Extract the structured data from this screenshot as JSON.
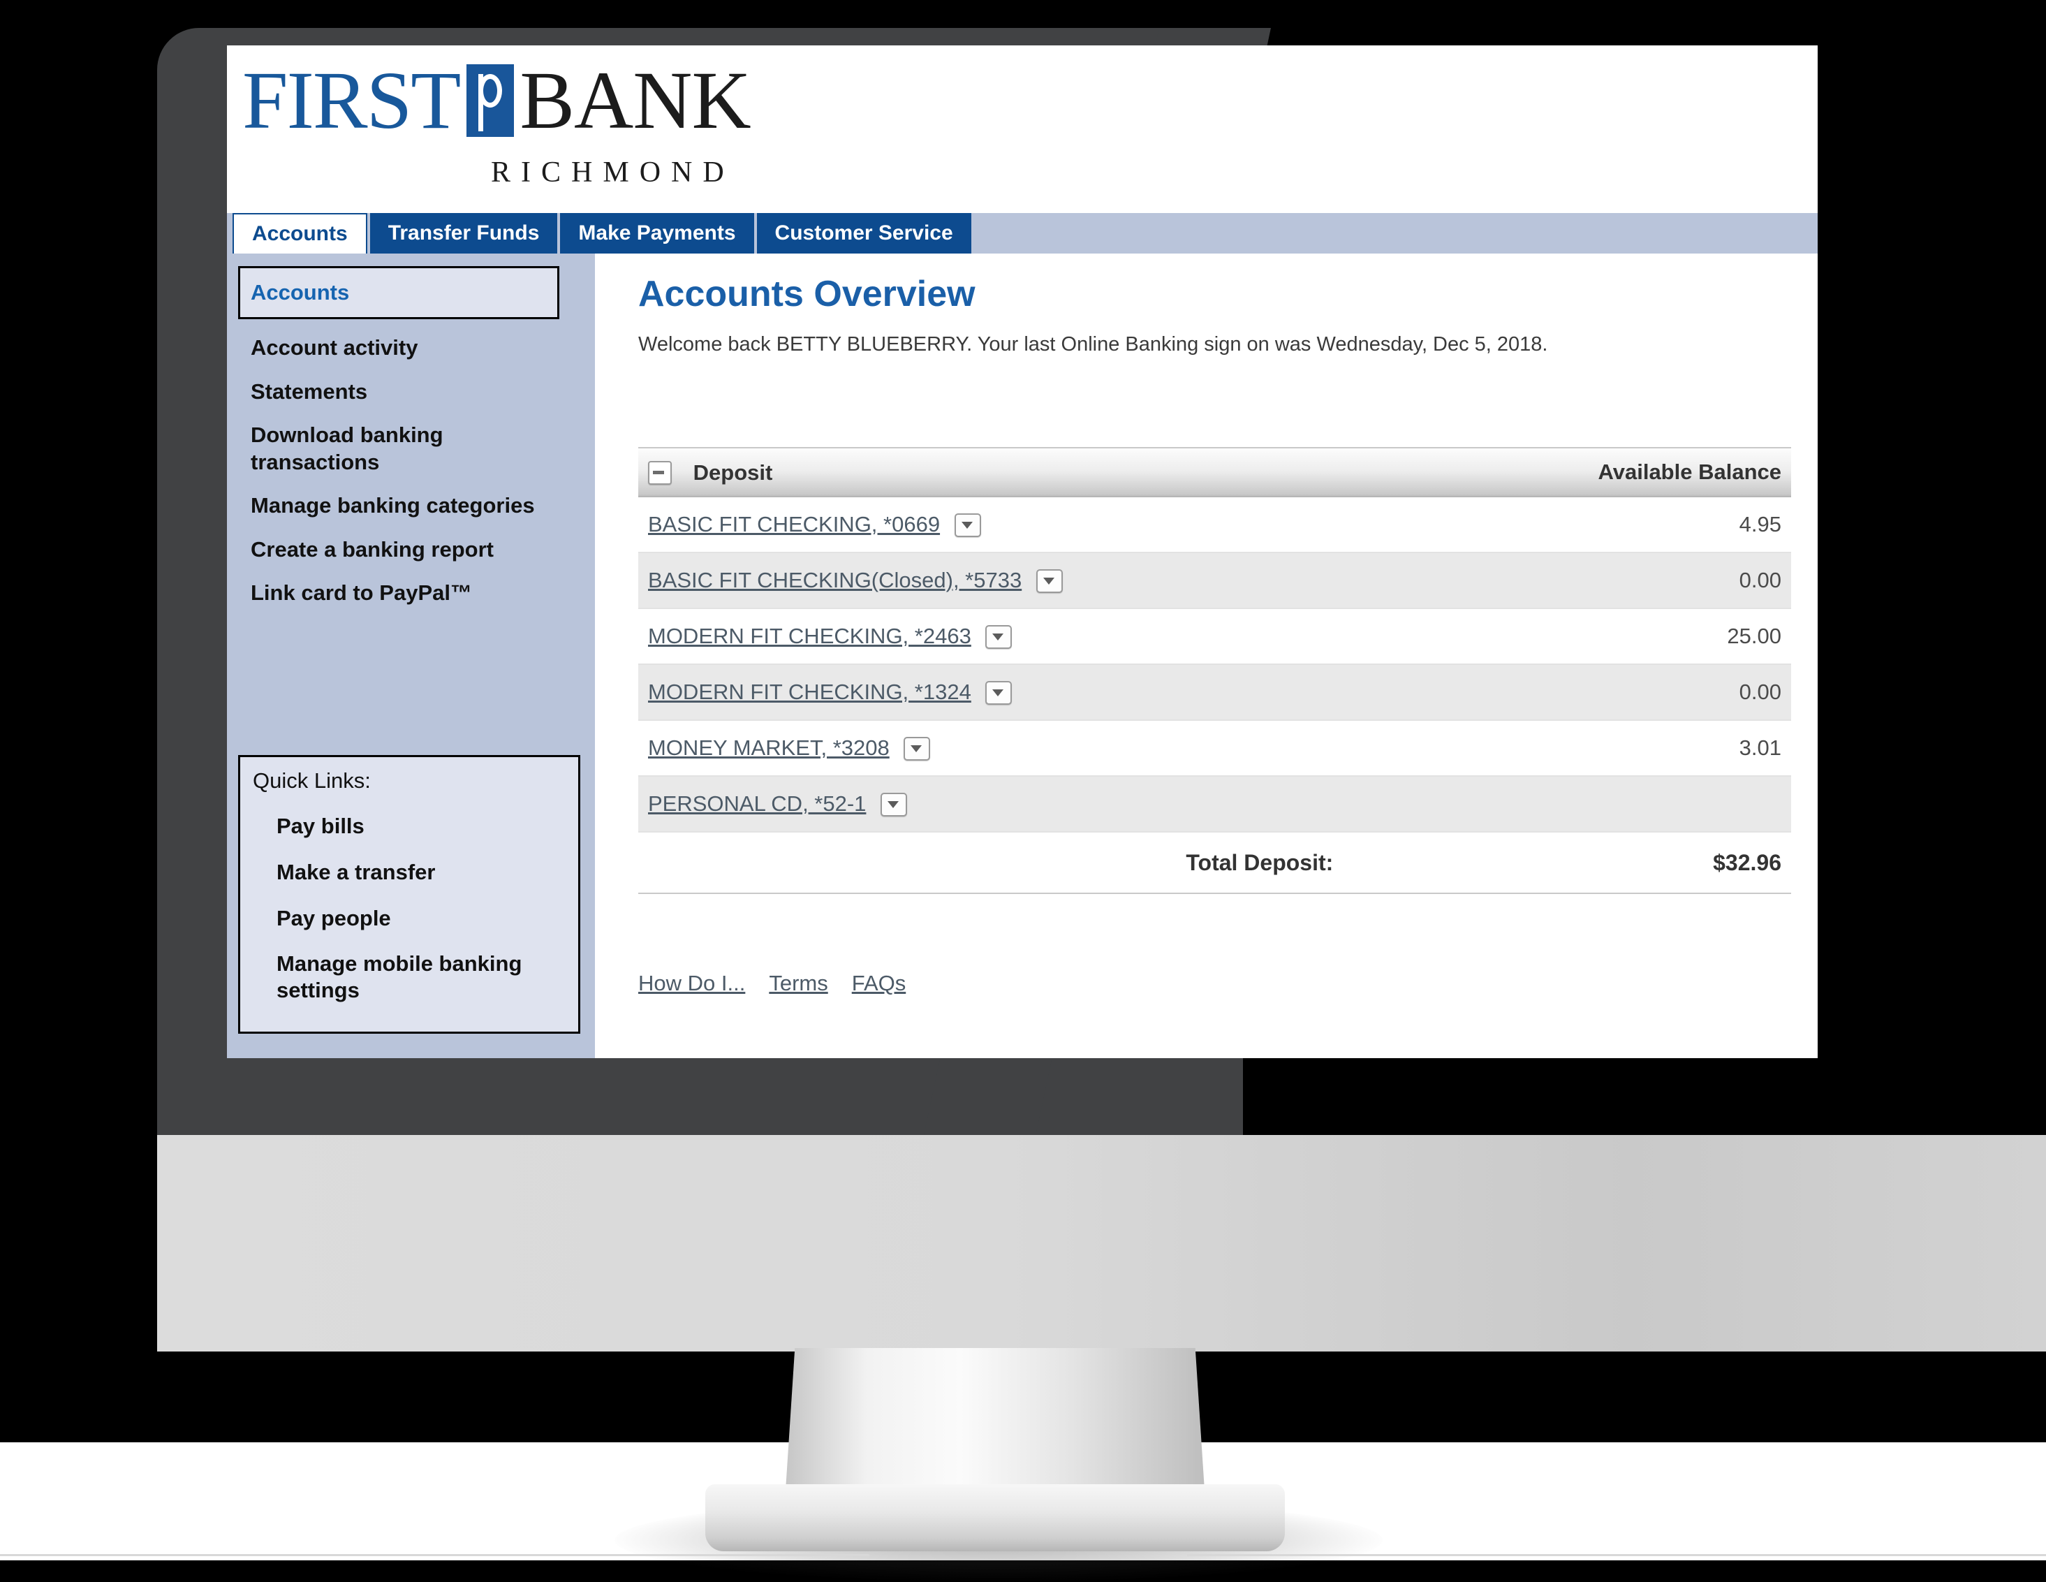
{
  "brand": {
    "word_first": "FIRST",
    "word_bank": "BANK",
    "subtitle": "RICHMOND",
    "brand_blue": "#18589b",
    "brand_black": "#1c1c1c"
  },
  "nav": {
    "tabs": [
      {
        "label": "Accounts",
        "active": true
      },
      {
        "label": "Transfer Funds",
        "active": false
      },
      {
        "label": "Make Payments",
        "active": false
      },
      {
        "label": "Customer Service",
        "active": false
      }
    ],
    "bar_color": "#b9c4da",
    "tab_color": "#0d4b8f"
  },
  "sidebar": {
    "items": [
      {
        "label": "Accounts",
        "current": true
      },
      {
        "label": "Account activity",
        "current": false
      },
      {
        "label": "Statements",
        "current": false
      },
      {
        "label": "Download banking transactions",
        "current": false
      },
      {
        "label": "Manage banking categories",
        "current": false
      },
      {
        "label": "Create a banking report",
        "current": false
      },
      {
        "label": "Link card to PayPal™",
        "current": false
      }
    ],
    "quick_links": {
      "title": "Quick Links:",
      "items": [
        {
          "label": "Pay bills"
        },
        {
          "label": "Make a transfer"
        },
        {
          "label": "Pay people"
        },
        {
          "label": "Manage mobile banking settings"
        }
      ]
    }
  },
  "main": {
    "title": "Accounts Overview",
    "welcome": "Welcome back BETTY BLUEBERRY. Your last Online Banking sign on was Wednesday, Dec 5, 2018.",
    "table": {
      "columns": {
        "name": "Deposit",
        "balance": "Available Balance"
      },
      "collapse_icon": "minus-box-icon",
      "rows": [
        {
          "name": "BASIC FIT CHECKING, *0669",
          "balance": "4.95"
        },
        {
          "name": "BASIC FIT CHECKING(Closed), *5733",
          "balance": "0.00"
        },
        {
          "name": "MODERN FIT CHECKING, *2463",
          "balance": "25.00"
        },
        {
          "name": "MODERN FIT CHECKING, *1324",
          "balance": "0.00"
        },
        {
          "name": "MONEY MARKET, *3208",
          "balance": "3.01"
        },
        {
          "name": "PERSONAL CD, *52-1",
          "balance": ""
        }
      ],
      "total_label": "Total Deposit:",
      "total_value": "$32.96"
    },
    "footer_links": [
      {
        "label": "How Do I..."
      },
      {
        "label": "Terms"
      },
      {
        "label": "FAQs"
      }
    ]
  }
}
